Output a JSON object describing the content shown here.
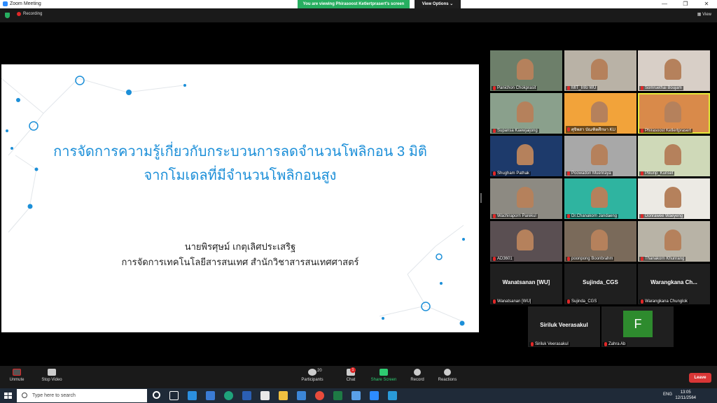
{
  "window": {
    "title": "Zoom Meeting",
    "controls": [
      "—",
      "❐",
      "✕"
    ]
  },
  "share_banner": "You are viewing Phirasoost Ketlertprasert's screen",
  "view_options": "View Options ⌄",
  "recording_label": "Recording",
  "view_label": "View",
  "slide": {
    "title_line1": "การจัดการความรู้เกี่ยวกับกระบวนการลดจำนวนโพลิกอน 3 มิติ",
    "title_line2": "จากโมเดลที่มีจำนวนโพลิกอนสูง",
    "author_line1": "นายพิรศุษม์ เกตุเลิศประเสริฐ",
    "author_line2": "การจัดการเทคโนโลยีสารสนเทศ สำนักวิชาสารสนเทศศาสตร์"
  },
  "participants": [
    {
      "name": "Panichon Chokprasit",
      "bg": "#6d7f6a"
    },
    {
      "name": "MIT_Info WU",
      "bg": "#b9b2a6"
    },
    {
      "name": "Somruethai Boujam",
      "bg": "#d8cfc7"
    },
    {
      "name": "Supansa Kaewjaijong",
      "bg": "#8aa08c"
    },
    {
      "name": "ศุจิพสา บัณฑิตศึกษา KU",
      "bg": "#f2a33a"
    },
    {
      "name": "Phirasoost Ketlertprasert",
      "bg": "#d98a4a"
    },
    {
      "name": "Shugham Pathak",
      "bg": "#1d3a6b"
    },
    {
      "name": "Poowadon Muenraya",
      "bg": "#a8a8a8"
    },
    {
      "name": "Pikunp_Kunset",
      "bg": "#cfd9b8"
    },
    {
      "name": "Wachiraporn Parekul",
      "bg": "#8d8a82"
    },
    {
      "name": "Dr.Chanakorn Jandaeng",
      "bg": "#2fb4a0"
    },
    {
      "name": "Donrawee Waeyeng",
      "bg": "#eceae4"
    },
    {
      "name": "AD3601",
      "bg": "#5a4f52"
    },
    {
      "name": "poonpong Boonbrahm",
      "bg": "#7a6a5a"
    },
    {
      "name": "Thanakorn Khunrang",
      "bg": "#b8b3a6"
    }
  ],
  "name_tiles": [
    {
      "display": "Wanatsanan [WU]",
      "label": "Wanatsanan [WU]"
    },
    {
      "display": "Sujinda_CGS",
      "label": "Sujinda_CGS"
    },
    {
      "display": "Warangkana  Ch...",
      "label": "Warangkana Chunglok"
    },
    {
      "display": "Siriluk Veerasakul",
      "label": "Siriluk Veerasakul"
    }
  ],
  "zahra": {
    "initial": "F",
    "label": "Zahra Ab"
  },
  "toolbar": {
    "unmute": "Unmute",
    "stop_video": "Stop Video",
    "participants": "Participants",
    "participants_count": "20",
    "chat": "Chat",
    "chat_badge": "1",
    "share_screen": "Share Screen",
    "record": "Record",
    "reactions": "Reactions",
    "leave": "Leave"
  },
  "taskbar": {
    "search_placeholder": "Type here to search",
    "lang": "ENG",
    "time": "13:05",
    "date": "12/11/2564"
  }
}
